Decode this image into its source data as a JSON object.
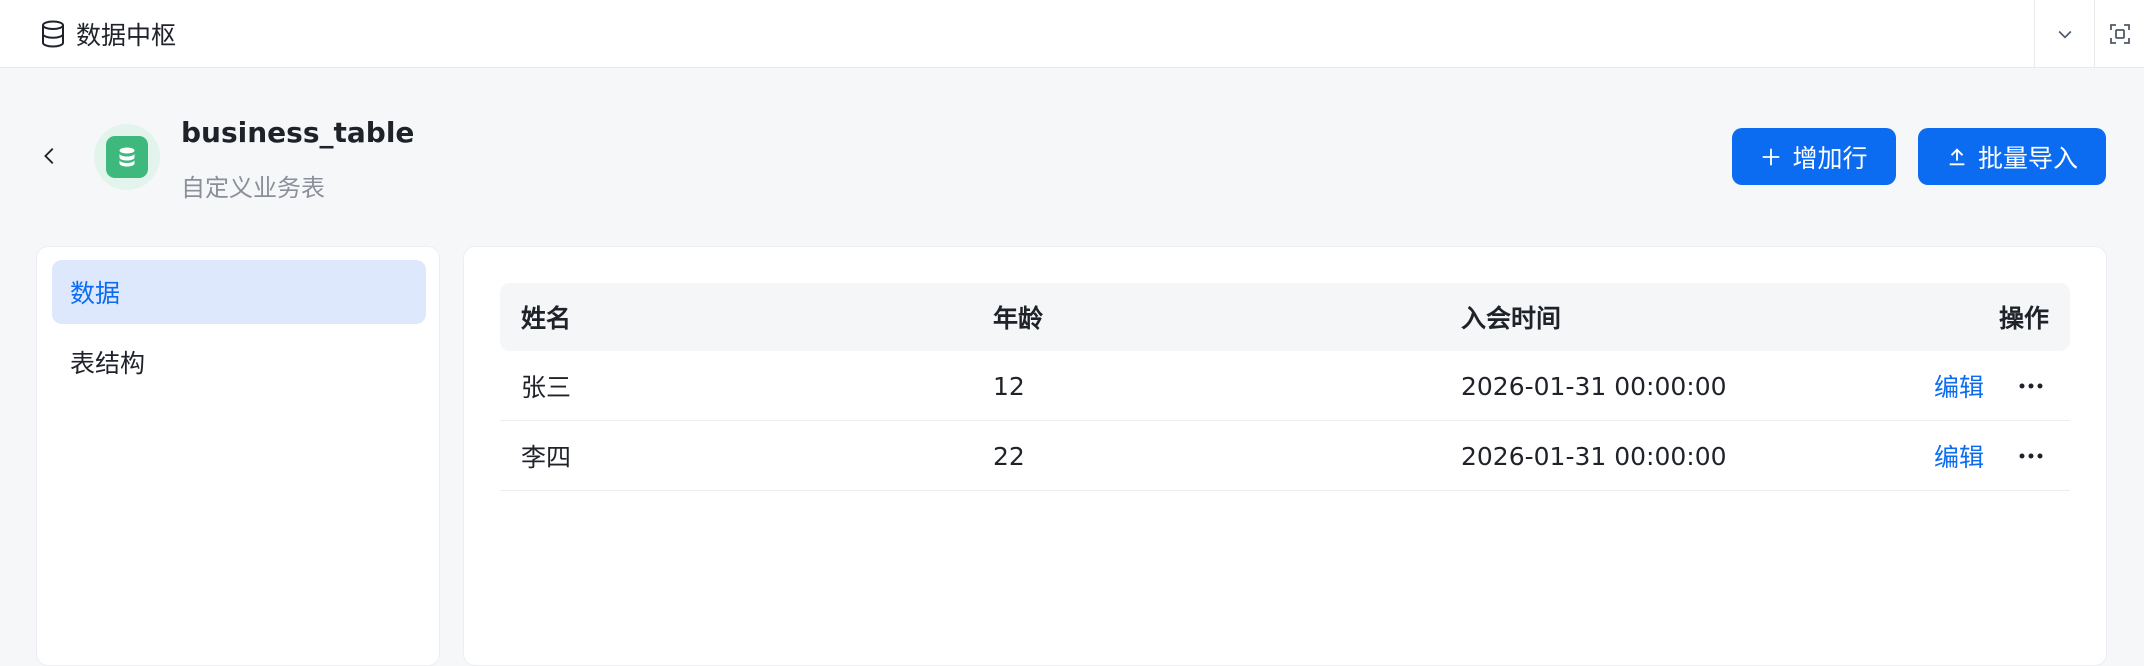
{
  "app": {
    "title": "数据中枢"
  },
  "header": {
    "table_name": "business_table",
    "table_desc": "自定义业务表",
    "add_row_label": "增加行",
    "import_label": "批量导入"
  },
  "sidebar": {
    "items": [
      {
        "label": "数据",
        "active": true
      },
      {
        "label": "表结构",
        "active": false
      }
    ]
  },
  "table": {
    "columns": [
      "姓名",
      "年龄",
      "入会时间",
      "操作"
    ],
    "rows": [
      {
        "name": "张三",
        "age": "12",
        "joined": "2026-01-31 00:00:00",
        "action": "编辑"
      },
      {
        "name": "李四",
        "age": "22",
        "joined": "2026-01-31 00:00:00",
        "action": "编辑"
      }
    ]
  },
  "icons": {
    "brand": "database-icon",
    "dropdown": "chevron-down-icon",
    "fullscreen": "fullscreen-icon",
    "back": "chevron-left-icon",
    "avatar": "database-icon",
    "add": "plus-icon",
    "import": "upload-icon",
    "more": "more-horizontal-icon"
  },
  "colors": {
    "accent": "#0b6cf2",
    "avatar_bg": "#e3f4ec",
    "avatar_fg": "#3fb87e",
    "active_bg": "#dde8fd"
  }
}
